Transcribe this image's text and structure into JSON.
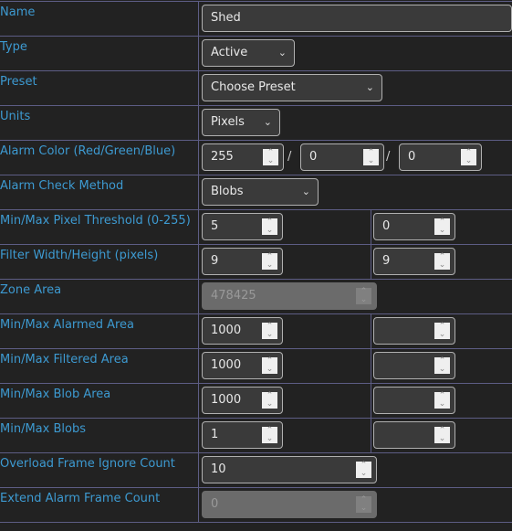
{
  "rows": [
    {
      "label": "Name",
      "value": "Shed"
    },
    {
      "label": "Type",
      "value": "Active"
    },
    {
      "label": "Preset",
      "value": "Choose Preset"
    },
    {
      "label": "Units",
      "value": "Pixels"
    },
    {
      "label": "Alarm Color (Red/Green/Blue)",
      "red": "255",
      "green": "0",
      "blue": "0"
    },
    {
      "label": "Alarm Check Method",
      "value": "Blobs"
    },
    {
      "label": "Min/Max Pixel Threshold (0-255)",
      "min": "5",
      "max": "0"
    },
    {
      "label": "Filter Width/Height (pixels)",
      "min": "9",
      "max": "9"
    },
    {
      "label": "Zone Area",
      "value": "478425"
    },
    {
      "label": "Min/Max Alarmed Area",
      "min": "1000",
      "max": ""
    },
    {
      "label": "Min/Max Filtered Area",
      "min": "1000",
      "max": ""
    },
    {
      "label": "Min/Max Blob Area",
      "min": "1000",
      "max": ""
    },
    {
      "label": "Min/Max Blobs",
      "min": "1",
      "max": ""
    },
    {
      "label": "Overload Frame Ignore Count",
      "value": "10"
    },
    {
      "label": "Extend Alarm Frame Count",
      "value": "0"
    }
  ],
  "slash": "/",
  "colors": {
    "label": "#3d9ad1",
    "background": "#222222",
    "border": "#5d5d85"
  }
}
